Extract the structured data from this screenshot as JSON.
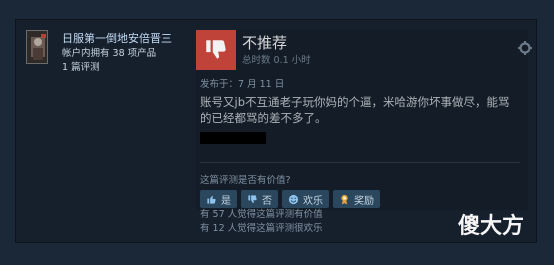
{
  "author": {
    "name": "日服第一倒地安倍晋三",
    "products": "帐户内拥有 38 项产品",
    "reviews": "1 篇评测"
  },
  "review": {
    "verdict": "不推荐",
    "hours": "总时数 0.1 小时",
    "posted": "发布于：7 月 11 日",
    "text": "账号又jb不互通老子玩你妈的个逼，米哈游你坏事做尽，能骂的已经都骂的差不多了。",
    "helpful_question": "这篇评测是否有价值?",
    "buttons": {
      "yes": "是",
      "no": "否",
      "funny": "欢乐",
      "award": "奖励"
    },
    "helpful_count": "有 57 人觉得这篇评测有价值",
    "funny_count": "有 12 人觉得这篇评测很欢乐"
  },
  "watermark": "傻大方",
  "icons": {
    "thumb": "thumbs-down-icon",
    "gear": "gear-icon",
    "yes": "thumbs-up-icon",
    "no": "thumbs-down-icon",
    "funny": "smile-icon",
    "award": "award-icon"
  },
  "colors": {
    "background": "#1b2838",
    "card": "#16202d",
    "thumb": "#c0433a",
    "button": "#2a475e"
  }
}
